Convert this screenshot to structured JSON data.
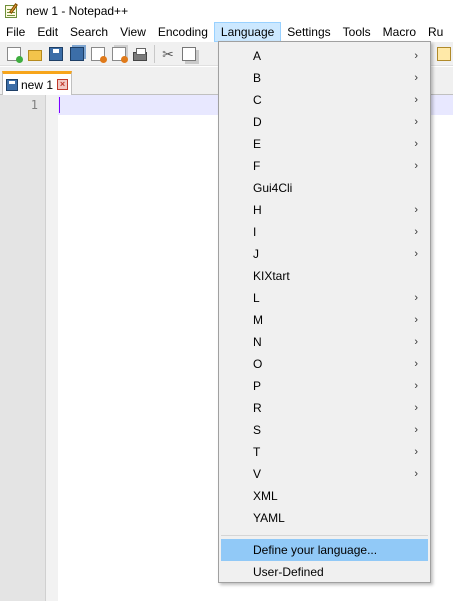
{
  "window": {
    "title": "new 1 - Notepad++"
  },
  "menubar": {
    "items": [
      "File",
      "Edit",
      "Search",
      "View",
      "Encoding",
      "Language",
      "Settings",
      "Tools",
      "Macro",
      "Ru"
    ]
  },
  "tabs": [
    {
      "label": "new 1",
      "close": "×"
    }
  ],
  "editor": {
    "line_number": "1"
  },
  "language_menu": {
    "items": [
      {
        "label": "A",
        "submenu": true
      },
      {
        "label": "B",
        "submenu": true
      },
      {
        "label": "C",
        "submenu": true
      },
      {
        "label": "D",
        "submenu": true
      },
      {
        "label": "E",
        "submenu": true
      },
      {
        "label": "F",
        "submenu": true
      },
      {
        "label": "Gui4Cli",
        "submenu": false
      },
      {
        "label": "H",
        "submenu": true
      },
      {
        "label": "I",
        "submenu": true
      },
      {
        "label": "J",
        "submenu": true
      },
      {
        "label": "KIXtart",
        "submenu": false
      },
      {
        "label": "L",
        "submenu": true
      },
      {
        "label": "M",
        "submenu": true
      },
      {
        "label": "N",
        "submenu": true
      },
      {
        "label": "O",
        "submenu": true
      },
      {
        "label": "P",
        "submenu": true
      },
      {
        "label": "R",
        "submenu": true
      },
      {
        "label": "S",
        "submenu": true
      },
      {
        "label": "T",
        "submenu": true
      },
      {
        "label": "V",
        "submenu": true
      },
      {
        "label": "XML",
        "submenu": false
      },
      {
        "label": "YAML",
        "submenu": false
      }
    ],
    "define_language": "Define your language...",
    "user_defined": "User-Defined",
    "arrow_glyph": "›"
  },
  "colors": {
    "menu_highlight": "#91c9f7",
    "tab_accent": "#f7a51b",
    "current_line": "#e8e8ff"
  }
}
